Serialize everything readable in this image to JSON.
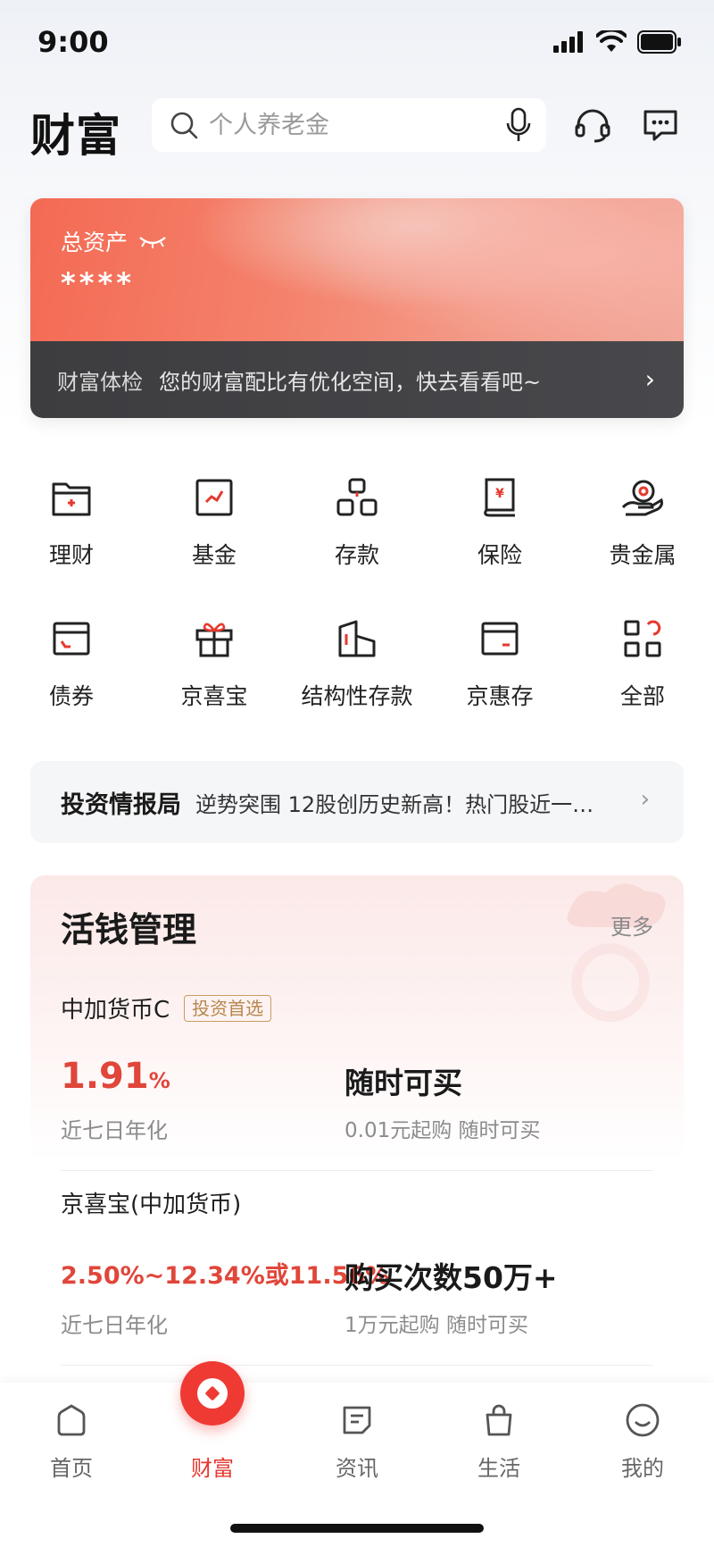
{
  "status": {
    "time": "9:00"
  },
  "header": {
    "title": "财富",
    "search_placeholder": "个人养老金"
  },
  "assets": {
    "label": "总资产",
    "value": "****",
    "checkup_title": "财富体检",
    "checkup_text": "您的财富配比有优化空间，快去看看吧~"
  },
  "menu": {
    "items": [
      {
        "label": "理财",
        "icon": "wealth-folder-icon"
      },
      {
        "label": "基金",
        "icon": "fund-chart-icon"
      },
      {
        "label": "存款",
        "icon": "deposit-blocks-icon"
      },
      {
        "label": "保险",
        "icon": "insurance-book-icon"
      },
      {
        "label": "贵金属",
        "icon": "precious-metal-hand-icon"
      },
      {
        "label": "债券",
        "icon": "bond-card-icon"
      },
      {
        "label": "京喜宝",
        "icon": "gift-box-icon"
      },
      {
        "label": "结构性存款",
        "icon": "building-icon"
      },
      {
        "label": "京惠存",
        "icon": "wallet-card-icon"
      },
      {
        "label": "全部",
        "icon": "all-grid-icon"
      }
    ]
  },
  "news": {
    "title": "投资情报局",
    "text": "逆势突围 12股创历史新高！热门股近一…"
  },
  "money": {
    "title": "活钱管理",
    "more": "更多",
    "products": [
      {
        "name": "中加货币C",
        "badge": "投资首选",
        "rate": "1.91",
        "rate_unit": "%",
        "rate_label": "近七日年化",
        "feature": "随时可买",
        "feature_sub": "0.01元起购   随时可买"
      },
      {
        "name": "京喜宝(中加货币)",
        "rate_range": "2.50%~12.34%或11.56%",
        "rate_label": "近七日年化",
        "feature": "购买次数50万+",
        "feature_sub": "1万元起购   随时可买"
      }
    ]
  },
  "tabs": [
    {
      "label": "首页",
      "icon": "home-icon"
    },
    {
      "label": "财富",
      "icon": "wealth-icon",
      "active": true
    },
    {
      "label": "资讯",
      "icon": "news-icon"
    },
    {
      "label": "生活",
      "icon": "shopping-bag-icon"
    },
    {
      "label": "我的",
      "icon": "smile-face-icon"
    }
  ],
  "colors": {
    "accent": "#e5392f",
    "card_gradient_start": "#f46a54",
    "badge": "#b7864d"
  }
}
